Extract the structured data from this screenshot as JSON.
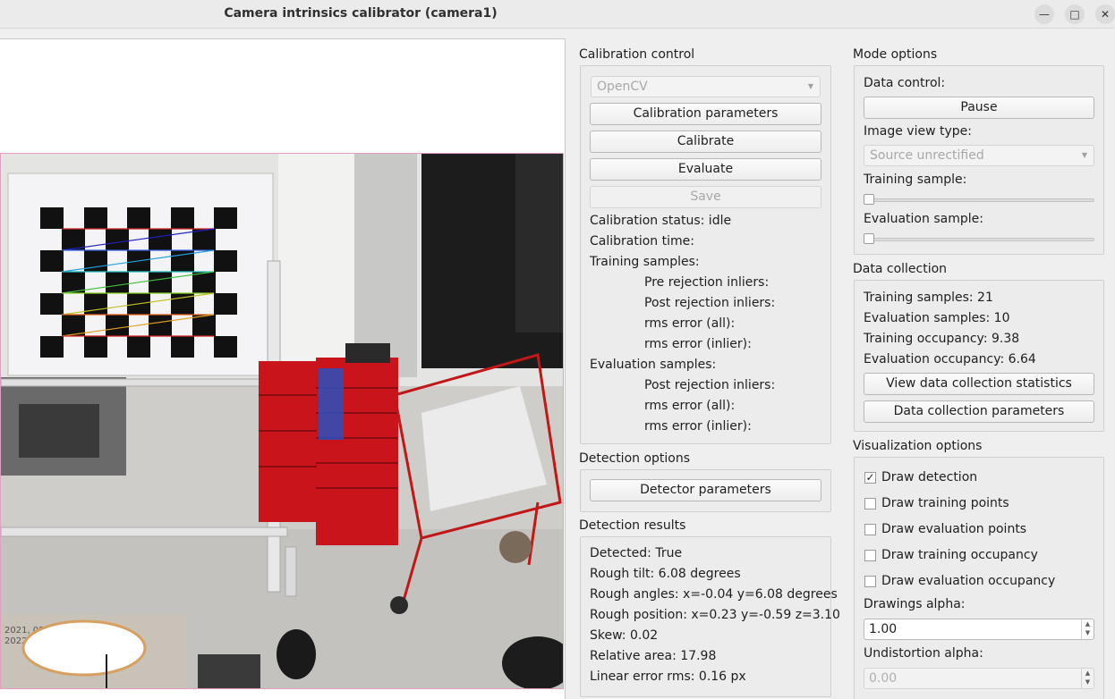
{
  "window": {
    "title": "Camera intrinsics calibrator (camera1)"
  },
  "calibration_control": {
    "title": "Calibration control",
    "method": "OpenCV",
    "calib_params_btn": "Calibration parameters",
    "calibrate_btn": "Calibrate",
    "evaluate_btn": "Evaluate",
    "save_btn": "Save",
    "status": "Calibration status: idle",
    "time": "Calibration time:",
    "training_samples": "Training samples:",
    "pre_rejection": "Pre rejection inliers:",
    "post_rejection": "Post rejection inliers:",
    "rms_all": "rms error (all):",
    "rms_inlier": "rms error (inlier):",
    "eval_samples": "Evaluation samples:",
    "eval_post_rejection": "Post rejection inliers:",
    "eval_rms_all": "rms error (all):",
    "eval_rms_inlier": "rms error (inlier):"
  },
  "detection_options": {
    "title": "Detection options",
    "detector_params_btn": "Detector parameters"
  },
  "detection_results": {
    "title": "Detection results",
    "detected": "Detected: True",
    "rough_tilt": "Rough tilt: 6.08 degrees",
    "rough_angles": "Rough angles: x=-0.04 y=6.08 degrees",
    "rough_position": "Rough position: x=0.23 y=-0.59 z=3.10",
    "skew": "Skew: 0.02",
    "relative_area": "Relative area: 17.98",
    "linear_error": "Linear error rms: 0.16 px"
  },
  "mode_options": {
    "title": "Mode options",
    "data_control": "Data control:",
    "pause_btn": "Pause",
    "image_view_type": "Image view type:",
    "view_type_value": "Source unrectified",
    "training_sample": "Training sample:",
    "evaluation_sample": "Evaluation sample:",
    "training_slider_value": 0,
    "evaluation_slider_value": 0
  },
  "data_collection": {
    "title": "Data collection",
    "training_samples": "Training samples: 21",
    "evaluation_samples": "Evaluation samples: 10",
    "training_occupancy": "Training occupancy: 9.38",
    "evaluation_occupancy": "Evaluation occupancy: 6.64",
    "view_stats_btn": "View data collection statistics",
    "params_btn": "Data collection parameters"
  },
  "visualization_options": {
    "title": "Visualization options",
    "draw_detection": "Draw detection",
    "draw_detection_checked": "✓",
    "draw_training_points": "Draw training points",
    "draw_evaluation_points": "Draw evaluation points",
    "draw_training_occupancy": "Draw training occupancy",
    "draw_evaluation_occupancy": "Draw evaluation occupancy",
    "drawings_alpha_label": "Drawings alpha:",
    "drawings_alpha": "1.00",
    "undistortion_alpha_label": "Undistortion alpha:",
    "undistortion_alpha": "0.00"
  },
  "camera_overlay": {
    "timestamp_line1": "2021, 08",
    "timestamp_line2": "2022"
  },
  "colors": {
    "accent_border": "#e0a0c0",
    "cart_red": "#c8141a",
    "checker": "#111111"
  }
}
